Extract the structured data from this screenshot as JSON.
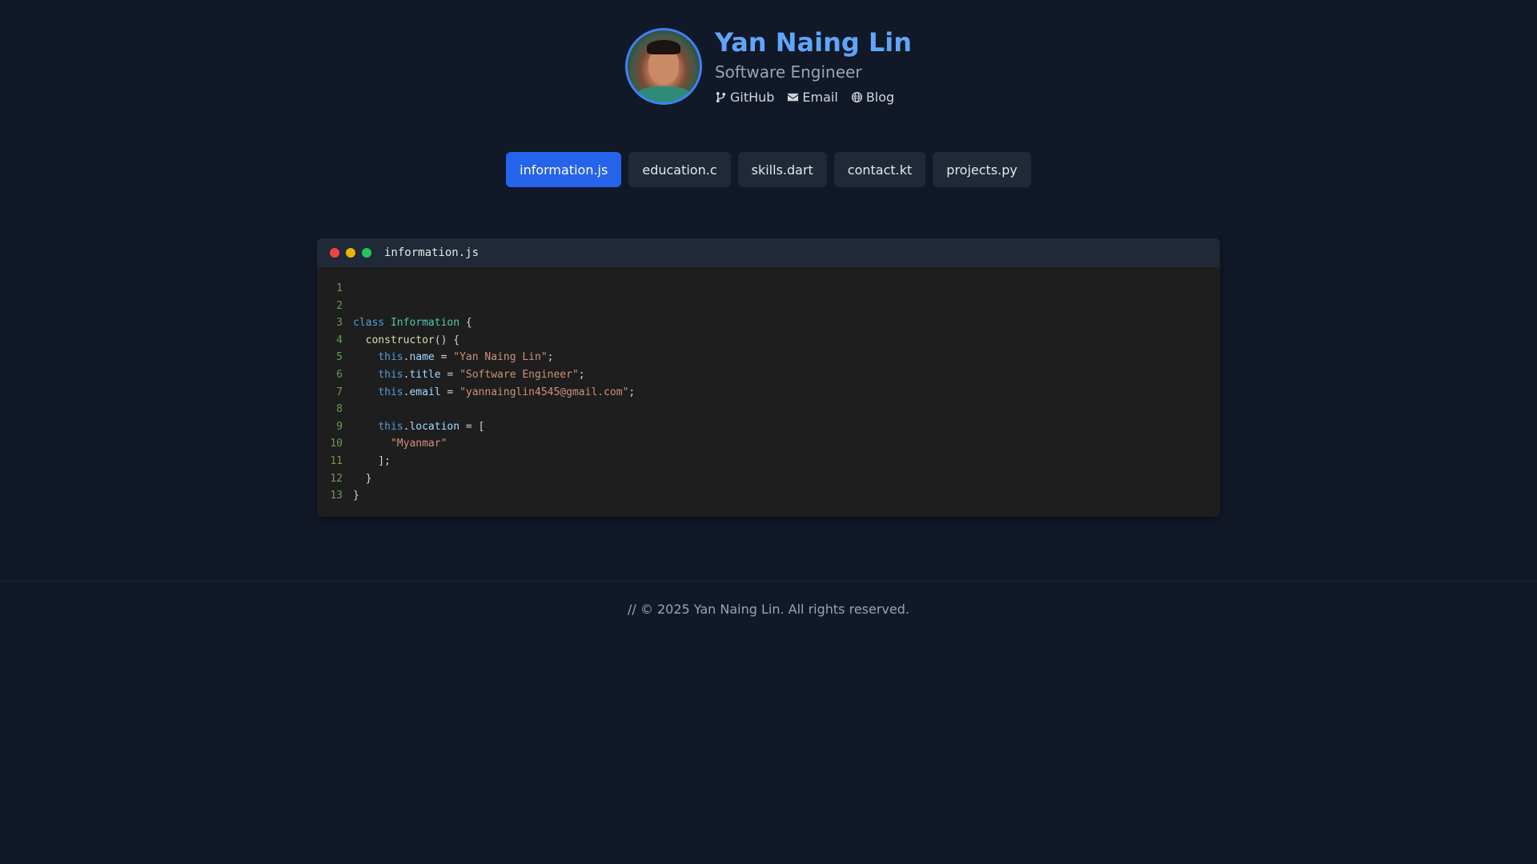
{
  "profile": {
    "name": "Yan Naing Lin",
    "title": "Software Engineer",
    "links": [
      {
        "label": "GitHub",
        "icon": "git-branch-icon"
      },
      {
        "label": "Email",
        "icon": "envelope-icon"
      },
      {
        "label": "Blog",
        "icon": "globe-icon"
      }
    ]
  },
  "tabs": [
    {
      "label": "information.js",
      "active": true
    },
    {
      "label": "education.c",
      "active": false
    },
    {
      "label": "skills.dart",
      "active": false
    },
    {
      "label": "contact.kt",
      "active": false
    },
    {
      "label": "projects.py",
      "active": false
    }
  ],
  "editor": {
    "filename": "information.js",
    "lines": [
      {
        "n": "1",
        "tokens": []
      },
      {
        "n": "2",
        "tokens": []
      },
      {
        "n": "3",
        "tokens": [
          [
            "kw",
            "class"
          ],
          [
            "p",
            " "
          ],
          [
            "cls",
            "Information"
          ],
          [
            "p",
            " {"
          ]
        ]
      },
      {
        "n": "4",
        "tokens": [
          [
            "p",
            "  "
          ],
          [
            "fn",
            "constructor"
          ],
          [
            "p",
            "() {"
          ]
        ]
      },
      {
        "n": "5",
        "tokens": [
          [
            "p",
            "    "
          ],
          [
            "kw",
            "this"
          ],
          [
            "p",
            "."
          ],
          [
            "prop",
            "name"
          ],
          [
            "p",
            " = "
          ],
          [
            "str",
            "\"Yan Naing Lin\""
          ],
          [
            "p",
            ";"
          ]
        ]
      },
      {
        "n": "6",
        "tokens": [
          [
            "p",
            "    "
          ],
          [
            "kw",
            "this"
          ],
          [
            "p",
            "."
          ],
          [
            "prop",
            "title"
          ],
          [
            "p",
            " = "
          ],
          [
            "str",
            "\"Software Engineer\""
          ],
          [
            "p",
            ";"
          ]
        ]
      },
      {
        "n": "7",
        "tokens": [
          [
            "p",
            "    "
          ],
          [
            "kw",
            "this"
          ],
          [
            "p",
            "."
          ],
          [
            "prop",
            "email"
          ],
          [
            "p",
            " = "
          ],
          [
            "str",
            "\"yannainglin4545@gmail.com\""
          ],
          [
            "p",
            ";"
          ]
        ]
      },
      {
        "n": "8",
        "tokens": []
      },
      {
        "n": "9",
        "tokens": [
          [
            "p",
            "    "
          ],
          [
            "kw",
            "this"
          ],
          [
            "p",
            "."
          ],
          [
            "prop",
            "location"
          ],
          [
            "p",
            " = ["
          ]
        ]
      },
      {
        "n": "10",
        "tokens": [
          [
            "p",
            "      "
          ],
          [
            "str",
            "\"Myanmar\""
          ]
        ]
      },
      {
        "n": "11",
        "tokens": [
          [
            "p",
            "    ];"
          ]
        ]
      },
      {
        "n": "12",
        "tokens": [
          [
            "p",
            "  }"
          ]
        ]
      },
      {
        "n": "13",
        "tokens": [
          [
            "p",
            "}"
          ]
        ]
      }
    ]
  },
  "footer": {
    "text": "// © 2025 Yan Naing Lin. All rights reserved."
  },
  "colors": {
    "background": "#111827",
    "accent": "#2563eb",
    "name": "#60a5fa"
  }
}
